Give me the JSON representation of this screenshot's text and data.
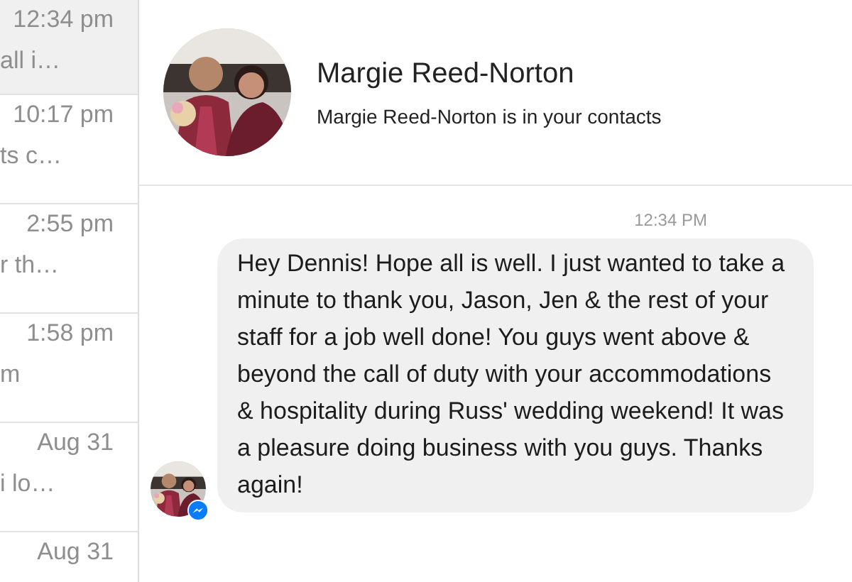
{
  "conversations": [
    {
      "time": "12:34 pm",
      "preview": "all i…",
      "selected": true
    },
    {
      "time": "10:17 pm",
      "preview": "ts c…",
      "selected": false
    },
    {
      "time": "2:55 pm",
      "preview": "r th…",
      "selected": false
    },
    {
      "time": "1:58 pm",
      "preview": "m",
      "selected": false
    },
    {
      "time": "Aug 31",
      "preview": "i lo…",
      "selected": false
    },
    {
      "time": "Aug 31",
      "selected": false
    }
  ],
  "contact": {
    "name": "Margie Reed-Norton",
    "subtitle": "Margie Reed-Norton is in your contacts"
  },
  "messages": [
    {
      "timestamp": "12:34 PM",
      "text": "Hey Dennis! Hope all is well. I just wanted to take a minute to thank you, Jason, Jen & the rest of your staff for a job well done! You guys went above & beyond the call of duty with your accommodations & hospitality during Russ' wedding weekend! It was a pleasure doing business with you guys. Thanks again!"
    }
  ]
}
